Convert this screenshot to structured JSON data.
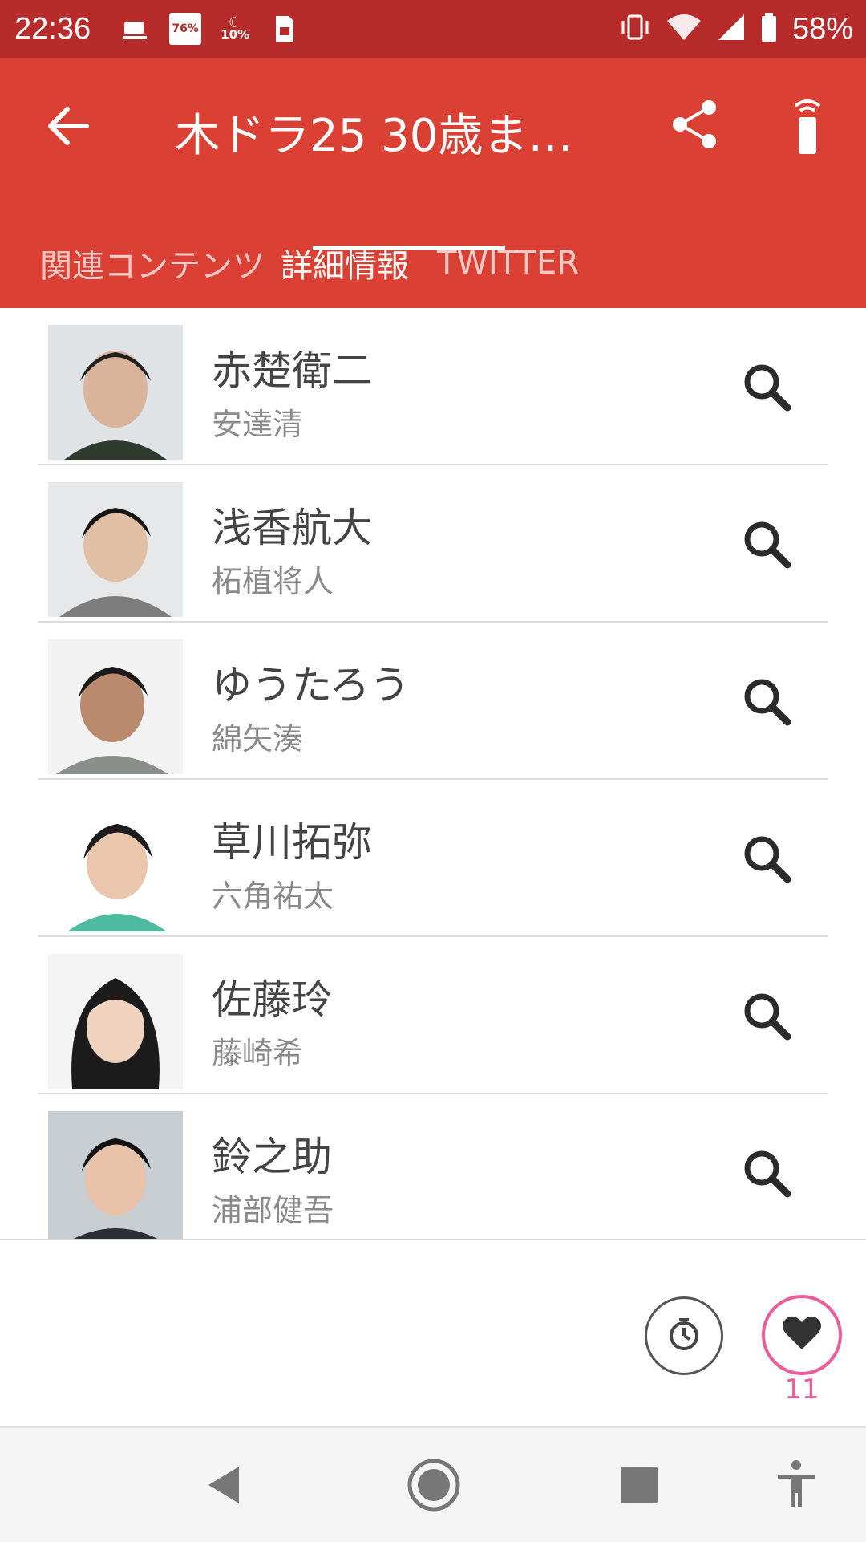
{
  "status_bar": {
    "time": "22:36",
    "icons": [
      "cup-icon",
      "76-badge-icon",
      "moon-10-icon",
      "sim-icon"
    ],
    "badge_76": "76%",
    "moon_10": "10%",
    "battery": "58%"
  },
  "app_bar": {
    "title": "木ドラ25 30歳ま…",
    "background": "#db4034"
  },
  "tabs": [
    {
      "label": "関連コンテンツ"
    },
    {
      "label": "詳細情報"
    },
    {
      "label": "TWITTER"
    }
  ],
  "cast": [
    {
      "character": "赤楚衛二",
      "actor": "安達清"
    },
    {
      "character": "浅香航大",
      "actor": "柘植将人"
    },
    {
      "character": "ゆうたろう",
      "actor": "綿矢湊"
    },
    {
      "character": "草川拓弥",
      "actor": "六角祐太"
    },
    {
      "character": "佐藤玲",
      "actor": "藤崎希"
    },
    {
      "character": "鈴之助",
      "actor": "浦部健吾"
    }
  ],
  "bottom": {
    "favorite_count": "11",
    "accent": "#ec5b9a"
  }
}
